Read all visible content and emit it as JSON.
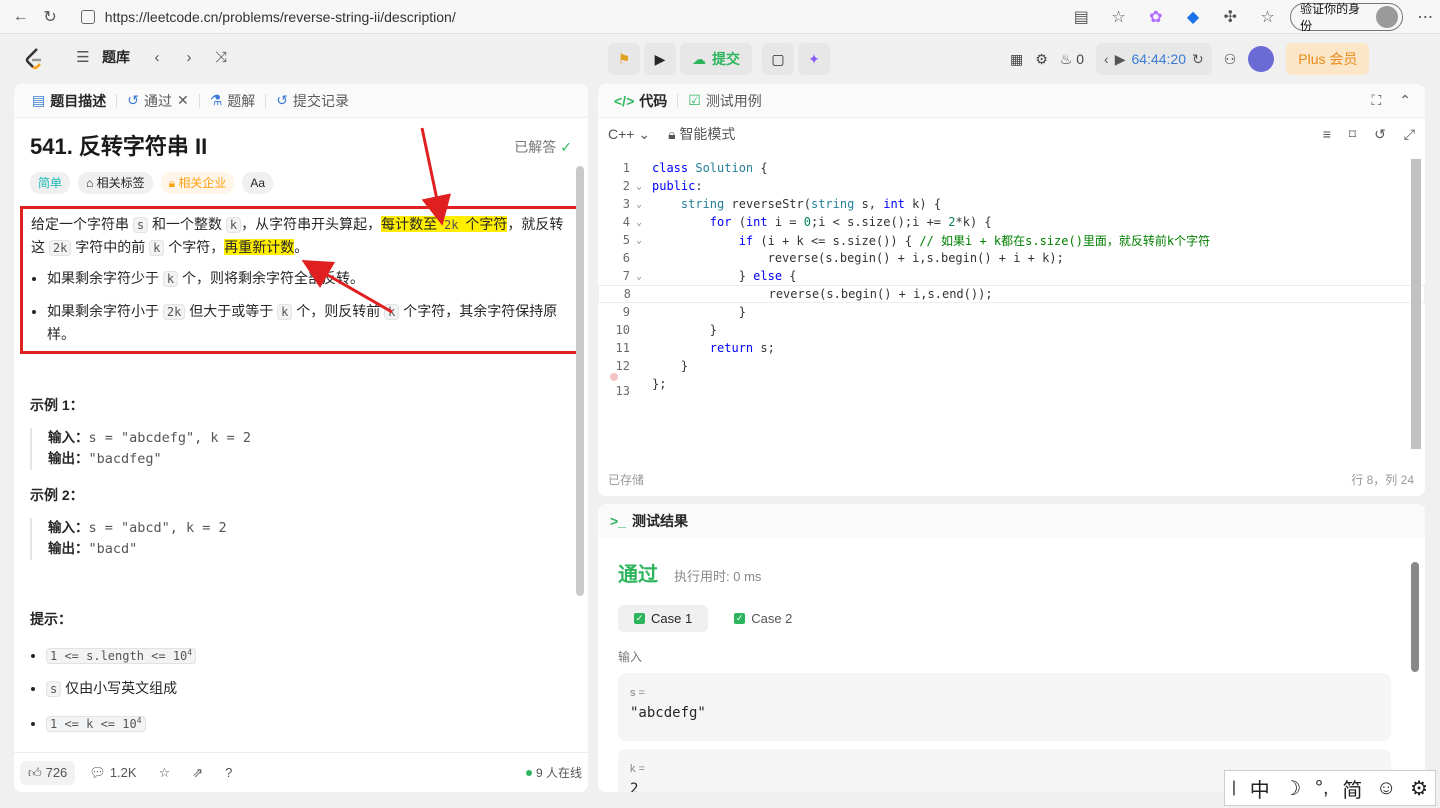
{
  "browser": {
    "url": "https://leetcode.cn/problems/reverse-string-ii/description/",
    "verify_label": "验证你的身份"
  },
  "nav": {
    "problem_bank": "题库",
    "submit": "提交",
    "fire_count": "0",
    "timer": "64:44:20",
    "plus_label": "Plus 会员"
  },
  "left_tabs": [
    {
      "label": "题目描述"
    },
    {
      "label": "通过"
    },
    {
      "label": "题解"
    },
    {
      "label": "提交记录"
    }
  ],
  "problem": {
    "title": "541. 反转字符串 II",
    "solved_label": "已解答",
    "tags": [
      "简单",
      "相关标签",
      "相关企业",
      "Aa"
    ],
    "desc_p1_a": "给定一个字符串 ",
    "desc_s": "s",
    "desc_p1_b": " 和一个整数 ",
    "desc_k": "k",
    "desc_p1_c": "，从字符串开头算起，",
    "desc_hl1_a": "每计数至 ",
    "desc_2k": "2k",
    "desc_hl1_b": " 个字符",
    "desc_p1_d": "，就反转这 ",
    "desc_p1_e": " 字符中的前 ",
    "desc_p1_f": " 个字符，",
    "desc_hl2": "再重新计数",
    "desc_p1_g": "。",
    "bullet1_a": "如果剩余字符少于 ",
    "bullet1_b": " 个，则将剩余字符全部反转。",
    "bullet2_a": "如果剩余字符小于 ",
    "bullet2_b": " 但大于或等于 ",
    "bullet2_c": " 个，则反转前 ",
    "bullet2_d": " 个字符，其余字符保持原样。",
    "example1_title": "示例 1：",
    "example1_input_label": "输入：",
    "example1_input": "s = \"abcdefg\", k = 2",
    "example1_output_label": "输出：",
    "example1_output": "\"bacdfeg\"",
    "example2_title": "示例 2：",
    "example2_input_label": "输入：",
    "example2_input": "s = \"abcd\", k = 2",
    "example2_output_label": "输出：",
    "example2_output": "\"bacd\"",
    "hints_title": "提示：",
    "hint1": "1 <= s.length <= 10",
    "hint1_sup": "4",
    "hint2_a": "s",
    "hint2_b": " 仅由小写英文组成",
    "hint3": "1 <= k <= 10",
    "hint3_sup": "4"
  },
  "bottom": {
    "likes": "726",
    "comments": "1.2K",
    "online": "9 人在线"
  },
  "editor": {
    "tab_code": "代码",
    "tab_tests": "测试用例",
    "language": "C++",
    "mode": "智能模式",
    "saved": "已存储",
    "cursor": "行 8，列 24",
    "lines": [
      "class Solution {",
      "public:",
      "    string reverseStr(string s, int k) {",
      "        for (int i = 0;i < s.size();i += 2*k) {",
      "            if (i + k <= s.size()) { // 如果i + k都在s.size()里面，就反转前k个字符",
      "                reverse(s.begin() + i,s.begin() + i + k);",
      "            } else {",
      "                reverse(s.begin() + i,s.end());",
      "            }",
      "        }",
      "        return s;",
      "    }",
      "};"
    ]
  },
  "result": {
    "header": "测试结果",
    "status": "通过",
    "runtime": "执行用时: 0 ms",
    "case1": "Case 1",
    "case2": "Case 2",
    "input_label": "输入",
    "var1": "s =",
    "val1": "\"abcdefg\"",
    "var2": "k =",
    "val2": "2"
  },
  "ime": [
    "中",
    "☽",
    "°,",
    "简",
    "☺",
    "⚙"
  ]
}
